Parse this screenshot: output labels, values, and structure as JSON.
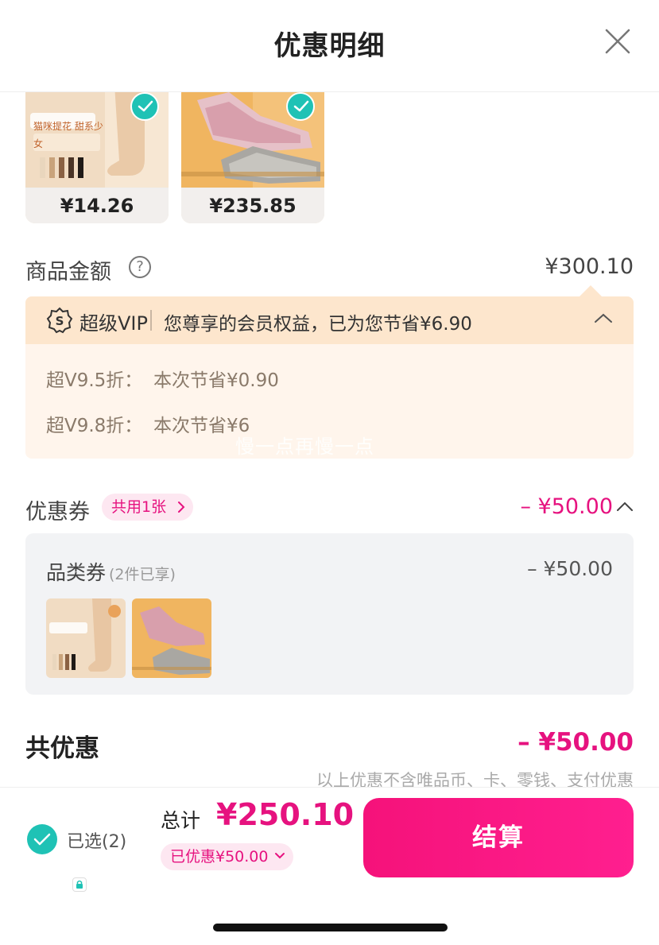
{
  "header": {
    "title": "优惠明细"
  },
  "products": [
    {
      "price": "¥14.26",
      "packaging_text": "猫咪提花 甜系少女"
    },
    {
      "price": "¥235.85"
    }
  ],
  "amount": {
    "label": "商品金额",
    "value": "¥300.10"
  },
  "vip": {
    "brand": "超级VIP",
    "summary": "您尊享的会员权益，已为您节省¥6.90",
    "lines": [
      {
        "name": "超V9.5折：",
        "saving": "本次节省¥0.90"
      },
      {
        "name": "超V9.8折：",
        "saving": "本次节省¥6"
      }
    ]
  },
  "watermark": "慢一点再慢一点",
  "coupon": {
    "label": "优惠券",
    "tag": "共用1张",
    "value": "– ¥50.00",
    "category_label": "品类券",
    "category_sub": "(2件已享)",
    "category_value": "– ¥50.00"
  },
  "total_discount": {
    "label": "共优惠",
    "value": "– ¥50.00"
  },
  "note": "以上优惠不含唯品币、卡、零钱、支付优惠",
  "bottom": {
    "selected": "已选(2)",
    "total_label": "总计",
    "total_value": "¥250.10",
    "saved": "已优惠¥50.00",
    "checkout": "结算"
  },
  "colors": {
    "accent": "#e6127f",
    "teal": "#1fc2b5",
    "vip_bg": "#fde6cd"
  },
  "icons": [
    "close-icon",
    "help-icon",
    "vip-shield-icon",
    "chevron-up-icon",
    "chevron-right-icon",
    "chevron-down-icon",
    "check-icon",
    "lock-icon"
  ]
}
